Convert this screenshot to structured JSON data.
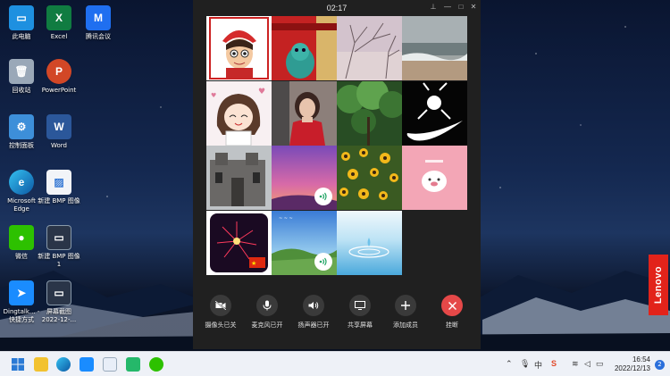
{
  "desktop": {
    "icons": [
      {
        "label": "此电脑"
      },
      {
        "label": "Excel"
      },
      {
        "label": "腾讯会议"
      },
      {
        "label": "回收站"
      },
      {
        "label": "PowerPoint"
      },
      {
        "label": "控制面板"
      },
      {
        "label": "Word"
      },
      {
        "label": "Microsoft Edge"
      },
      {
        "label": "新建 BMP 图像"
      },
      {
        "label": "微信"
      },
      {
        "label": "新建 BMP 图像1"
      },
      {
        "label": "Dingtalk... - 快捷方式"
      },
      {
        "label": "屏幕截图 2022-12-..."
      }
    ],
    "brand": "Lenovo"
  },
  "meeting": {
    "timer": "02:17",
    "participants": [
      {
        "name": "cartoon-avatar-participant"
      },
      {
        "name": "lion-statue-participant"
      },
      {
        "name": "sky-branches-participant"
      },
      {
        "name": "beach-participant"
      },
      {
        "name": "anime-girl-participant"
      },
      {
        "name": "woman-red-scarf-participant"
      },
      {
        "name": "trees-participant"
      },
      {
        "name": "nike-logo-participant"
      },
      {
        "name": "old-building-participant"
      },
      {
        "name": "sunset-participant",
        "speaking": true
      },
      {
        "name": "flowers-participant"
      },
      {
        "name": "pink-cartoon-participant"
      },
      {
        "name": "fireworks-participant"
      },
      {
        "name": "bay-landscape-participant",
        "speaking": true
      },
      {
        "name": "water-drop-participant"
      }
    ],
    "controls": {
      "camera": "摄像头已关",
      "mic": "麦克风已开",
      "speaker": "扬声器已开",
      "share": "共享屏幕",
      "add": "添加成员",
      "hangup": "挂断"
    }
  },
  "taskbar": {
    "ime": "中",
    "time": "16:54",
    "date": "2022/12/13",
    "notifications": "2"
  },
  "colors": {
    "hangup": "#e54848",
    "window_bg": "#202020",
    "lenovo": "#e2231a"
  }
}
